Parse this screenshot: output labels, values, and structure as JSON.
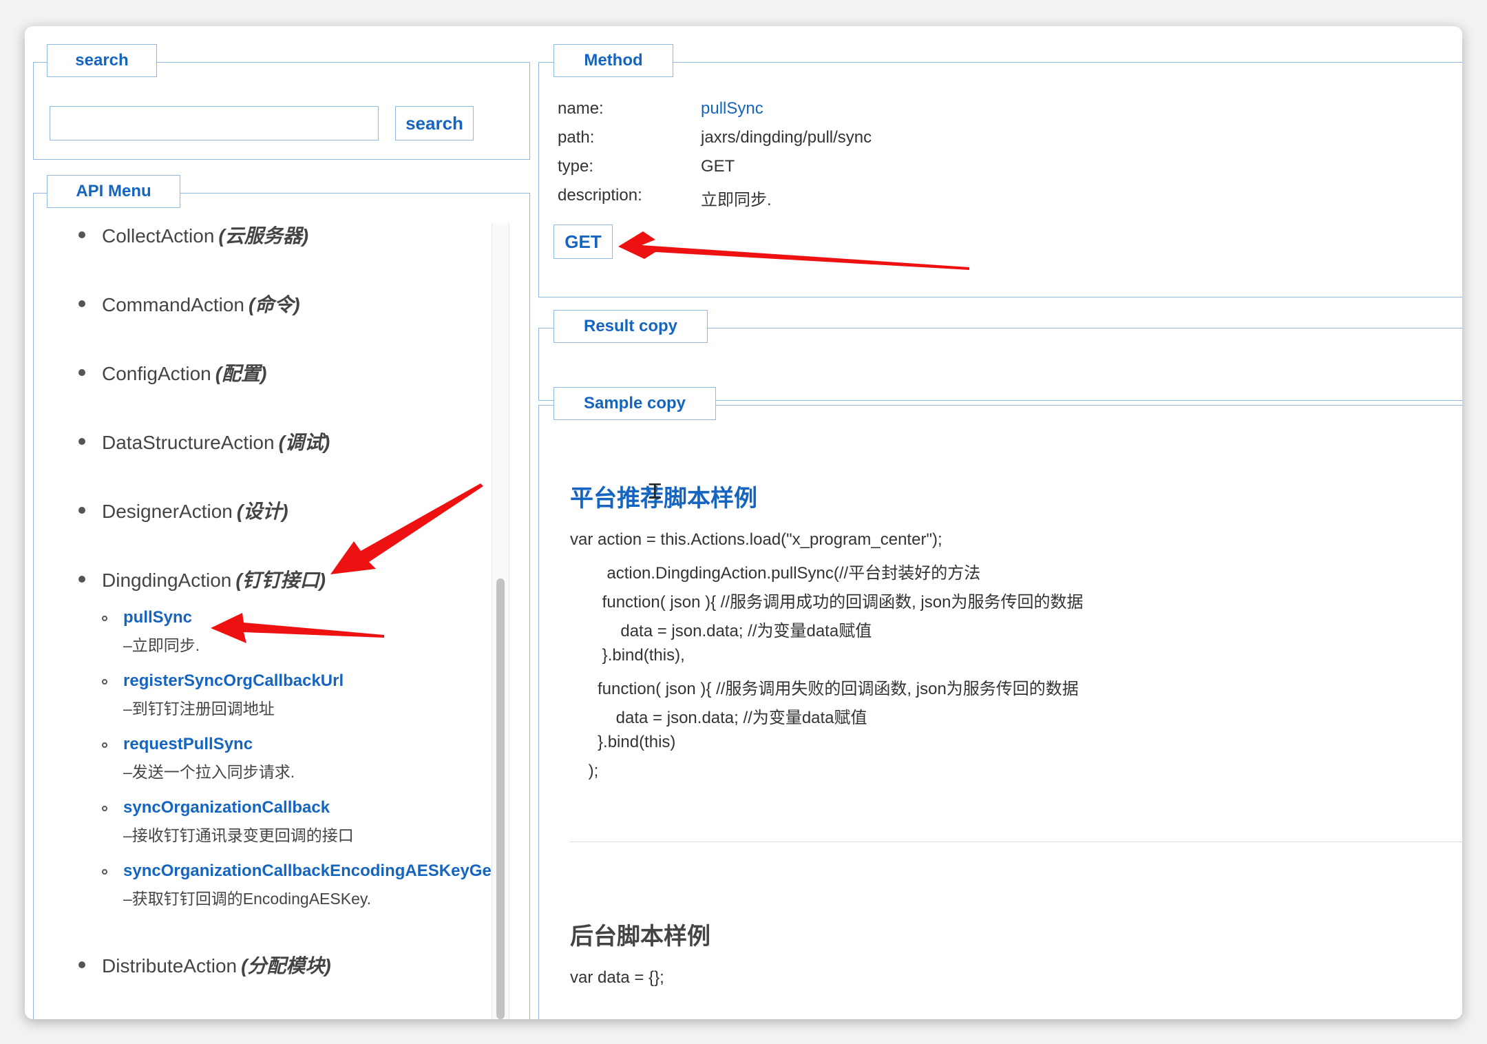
{
  "search_panel": {
    "legend": "search",
    "input_value": "",
    "input_placeholder": "",
    "button_label": "search"
  },
  "api_menu": {
    "legend": "API Menu",
    "actions": [
      {
        "name": "CollectAction",
        "cn": "(云服务器)"
      },
      {
        "name": "CommandAction",
        "cn": "(命令)"
      },
      {
        "name": "ConfigAction",
        "cn": "(配置)"
      },
      {
        "name": "DataStructureAction",
        "cn": "(调试)"
      },
      {
        "name": "DesignerAction",
        "cn": "(设计)"
      },
      {
        "name": "DingdingAction",
        "cn": "(钉钉接口)"
      },
      {
        "name": "DistributeAction",
        "cn": "(分配模块)"
      }
    ],
    "dingding_methods": [
      {
        "name": "pullSync",
        "desc": "–立即同步."
      },
      {
        "name": "registerSyncOrgCallbackUrl",
        "desc": "–到钉钉注册回调地址"
      },
      {
        "name": "requestPullSync",
        "desc": "–发送一个拉入同步请求."
      },
      {
        "name": "syncOrganizationCallback",
        "desc": "–接收钉钉通讯录变更回调的接口"
      },
      {
        "name": "syncOrganizationCallbackEncodingAESKeyGet",
        "desc": "–获取钉钉回调的EncodingAESKey."
      }
    ]
  },
  "method_panel": {
    "legend": "Method",
    "labels": {
      "name": "name:",
      "path": "path:",
      "type": "type:",
      "description": "description:"
    },
    "values": {
      "name": "pullSync",
      "path": "jaxrs/dingding/pull/sync",
      "type": "GET",
      "description": "立即同步."
    },
    "get_button": "GET"
  },
  "result_panel": {
    "legend": "Result copy"
  },
  "sample_panel": {
    "legend": "Sample copy",
    "platform_title": "平台推荐脚本样例",
    "platform_code": [
      "var action = this.Actions.load(\"x_program_center\");",
      "        action.DingdingAction.pullSync(//平台封装好的方法",
      "       function( json ){ //服务调用成功的回调函数, json为服务传回的数据",
      "           data = json.data; //为变量data赋值",
      "       }.bind(this),",
      "      function( json ){ //服务调用失败的回调函数, json为服务传回的数据",
      "          data = json.data; //为变量data赋值",
      "      }.bind(this)",
      "    );"
    ],
    "backend_title": "后台脚本样例",
    "backend_code": [
      "var data = {};"
    ]
  },
  "colors": {
    "accent": "#1565c0",
    "border": "#90b8e0",
    "arrow": "#ee1111"
  }
}
